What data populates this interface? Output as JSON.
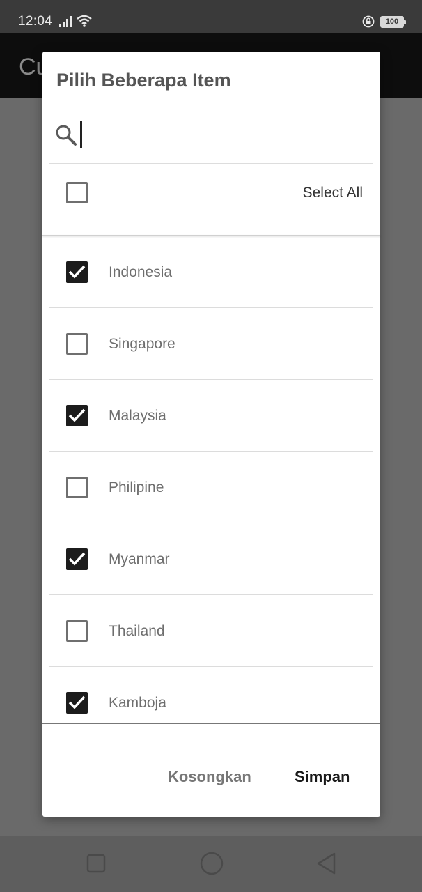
{
  "status_bar": {
    "time": "12:04",
    "battery": "100"
  },
  "app_bar": {
    "title": "Cu"
  },
  "dialog": {
    "title": "Pilih Beberapa Item",
    "search": {
      "value": "",
      "placeholder": ""
    },
    "select_all": {
      "label": "Select All",
      "checked": false
    },
    "items": [
      {
        "label": "Indonesia",
        "checked": true
      },
      {
        "label": "Singapore",
        "checked": false
      },
      {
        "label": "Malaysia",
        "checked": true
      },
      {
        "label": "Philipine",
        "checked": false
      },
      {
        "label": "Myanmar",
        "checked": true
      },
      {
        "label": "Thailand",
        "checked": false
      },
      {
        "label": "Kamboja",
        "checked": true
      }
    ],
    "buttons": {
      "clear_label": "Kosongkan",
      "save_label": "Simpan"
    }
  },
  "colors": {
    "checkbox_on": "#1c1c1c",
    "checkbox_off_border": "#6f6f6f",
    "scrim": "#6a6a6a"
  },
  "icons": {
    "signal": "signal-icon",
    "wifi": "wifi-icon",
    "lock": "rotation-lock-icon",
    "battery": "battery-icon",
    "search": "search-icon",
    "check": "check-icon",
    "nav_recents": "square-icon",
    "nav_home": "circle-icon",
    "nav_back": "triangle-back-icon"
  }
}
